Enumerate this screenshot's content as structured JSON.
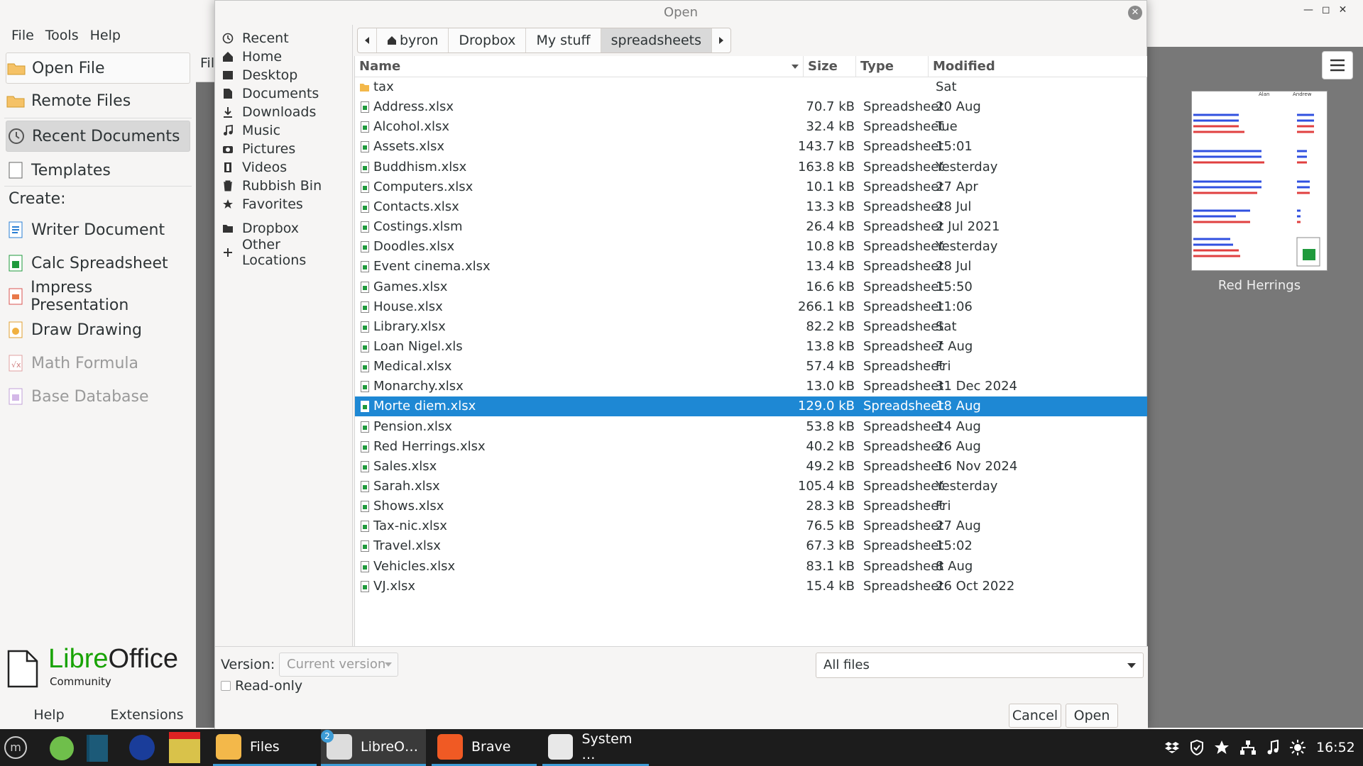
{
  "menubar": {
    "items": [
      "File",
      "Tools",
      "Help"
    ]
  },
  "start_center": {
    "open_file": "Open File",
    "remote_files": "Remote Files",
    "recent_documents": "Recent Documents",
    "templates": "Templates",
    "create_label": "Create:",
    "create_items": [
      "Writer Document",
      "Calc Spreadsheet",
      "Impress Presentation",
      "Draw Drawing",
      "Math Formula",
      "Base Database"
    ],
    "logo": {
      "libre": "Libre",
      "office": "Office",
      "edition": "Community"
    },
    "footer": {
      "help": "Help",
      "extensions": "Extensions"
    },
    "toolbar_partial": "Fil",
    "thumbnail": {
      "title": "Red Herrings",
      "col1": "Alan",
      "col2": "Andrew"
    }
  },
  "dialog": {
    "title": "Open",
    "places": [
      "Recent",
      "Home",
      "Desktop",
      "Documents",
      "Downloads",
      "Music",
      "Pictures",
      "Videos",
      "Rubbish Bin",
      "Favorites",
      "Dropbox",
      "Other Locations"
    ],
    "path": [
      "byron",
      "Dropbox",
      "My stuff",
      "spreadsheets"
    ],
    "columns": {
      "name": "Name",
      "size": "Size",
      "type": "Type",
      "modified": "Modified"
    },
    "files": [
      {
        "name": "tax",
        "size": "",
        "type": "",
        "modified": "Sat",
        "folder": true
      },
      {
        "name": "Address.xlsx",
        "size": "70.7 kB",
        "type": "Spreadsheet",
        "modified": "20 Aug"
      },
      {
        "name": "Alcohol.xlsx",
        "size": "32.4 kB",
        "type": "Spreadsheet",
        "modified": "Tue"
      },
      {
        "name": "Assets.xlsx",
        "size": "143.7 kB",
        "type": "Spreadsheet",
        "modified": "15:01"
      },
      {
        "name": "Buddhism.xlsx",
        "size": "163.8 kB",
        "type": "Spreadsheet",
        "modified": "Yesterday"
      },
      {
        "name": "Computers.xlsx",
        "size": "10.1 kB",
        "type": "Spreadsheet",
        "modified": "27 Apr"
      },
      {
        "name": "Contacts.xlsx",
        "size": "13.3 kB",
        "type": "Spreadsheet",
        "modified": "28 Jul"
      },
      {
        "name": "Costings.xlsm",
        "size": "26.4 kB",
        "type": "Spreadsheet",
        "modified": "2 Jul 2021"
      },
      {
        "name": "Doodles.xlsx",
        "size": "10.8 kB",
        "type": "Spreadsheet",
        "modified": "Yesterday"
      },
      {
        "name": "Event cinema.xlsx",
        "size": "13.4 kB",
        "type": "Spreadsheet",
        "modified": "28 Jul"
      },
      {
        "name": "Games.xlsx",
        "size": "16.6 kB",
        "type": "Spreadsheet",
        "modified": "15:50"
      },
      {
        "name": "House.xlsx",
        "size": "266.1 kB",
        "type": "Spreadsheet",
        "modified": "11:06"
      },
      {
        "name": "Library.xlsx",
        "size": "82.2 kB",
        "type": "Spreadsheet",
        "modified": "Sat"
      },
      {
        "name": "Loan Nigel.xls",
        "size": "13.8 kB",
        "type": "Spreadsheet",
        "modified": "7 Aug"
      },
      {
        "name": "Medical.xlsx",
        "size": "57.4 kB",
        "type": "Spreadsheet",
        "modified": "Fri"
      },
      {
        "name": "Monarchy.xlsx",
        "size": "13.0 kB",
        "type": "Spreadsheet",
        "modified": "31 Dec 2024"
      },
      {
        "name": "Morte diem.xlsx",
        "size": "129.0 kB",
        "type": "Spreadsheet",
        "modified": "18 Aug",
        "selected": true
      },
      {
        "name": "Pension.xlsx",
        "size": "53.8 kB",
        "type": "Spreadsheet",
        "modified": "14 Aug"
      },
      {
        "name": "Red Herrings.xlsx",
        "size": "40.2 kB",
        "type": "Spreadsheet",
        "modified": "26 Aug"
      },
      {
        "name": "Sales.xlsx",
        "size": "49.2 kB",
        "type": "Spreadsheet",
        "modified": "16 Nov 2024"
      },
      {
        "name": "Sarah.xlsx",
        "size": "105.4 kB",
        "type": "Spreadsheet",
        "modified": "Yesterday"
      },
      {
        "name": "Shows.xlsx",
        "size": "28.3 kB",
        "type": "Spreadsheet",
        "modified": "Fri"
      },
      {
        "name": "Tax-nic.xlsx",
        "size": "76.5 kB",
        "type": "Spreadsheet",
        "modified": "27 Aug"
      },
      {
        "name": "Travel.xlsx",
        "size": "67.3 kB",
        "type": "Spreadsheet",
        "modified": "15:02"
      },
      {
        "name": "Vehicles.xlsx",
        "size": "83.1 kB",
        "type": "Spreadsheet",
        "modified": "8 Aug"
      },
      {
        "name": "VJ.xlsx",
        "size": "15.4 kB",
        "type": "Spreadsheet",
        "modified": "26 Oct 2022"
      }
    ],
    "version_label": "Version:",
    "version_value": "Current version",
    "readonly_label": "Read-only",
    "filter_value": "All files",
    "cancel": "Cancel",
    "open": "Open"
  },
  "taskbar": {
    "apps": [
      {
        "label": "Files"
      },
      {
        "label": "LibreO…",
        "badge": "2"
      },
      {
        "label": "Brave"
      },
      {
        "label": "System …"
      }
    ],
    "clock": "16:52"
  },
  "colors": {
    "selection": "#1e88d4",
    "logo_green": "#18a303",
    "taskbar": "#1c1c1c"
  }
}
